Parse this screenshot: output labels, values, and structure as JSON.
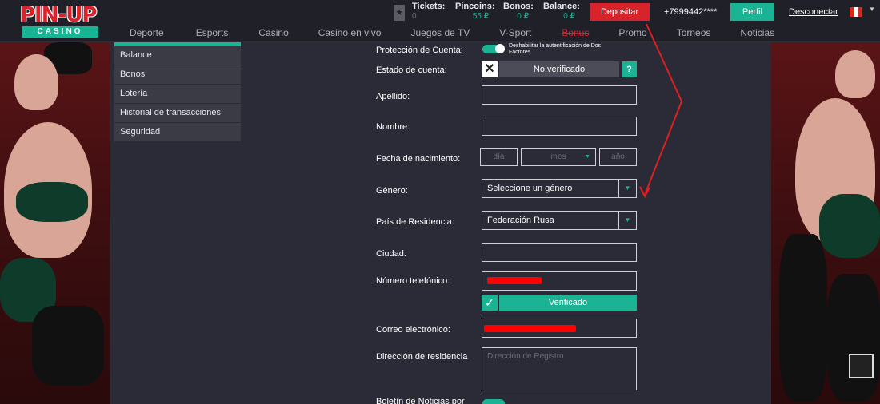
{
  "brand": {
    "logo_top": "PIN-UP",
    "logo_bottom": "CASINO"
  },
  "nav": [
    {
      "label": "Deporte"
    },
    {
      "label": "Esports"
    },
    {
      "label": "Casino"
    },
    {
      "label": "Casino en vivo"
    },
    {
      "label": "Juegos de TV"
    },
    {
      "label": "V-Sport"
    },
    {
      "label": "Bonus"
    },
    {
      "label": "Promo"
    },
    {
      "label": "Torneos"
    },
    {
      "label": "Noticias"
    }
  ],
  "account": {
    "tickets_label": "Tickets:",
    "tickets_value": "0",
    "pincoins_label": "Pincoins:",
    "pincoins_value": "55 ₽",
    "bonos_label": "Bonos:",
    "bonos_value": "0 ₽",
    "balance_label": "Balance:",
    "balance_value": "0 ₽",
    "deposit_label": "Depositar",
    "phone": "+7999442****",
    "profile_label": "Perfil",
    "logout_label": "Desconectar"
  },
  "sidebar": {
    "items": [
      {
        "label": "Balance"
      },
      {
        "label": "Bonos"
      },
      {
        "label": "Lotería"
      },
      {
        "label": "Historial de transacciones"
      },
      {
        "label": "Seguridad"
      }
    ]
  },
  "form": {
    "protection_label": "Protección de Cuenta:",
    "tfa_text": "Deshabilitar la autentificación de Dos Factores",
    "status_label": "Estado de cuenta:",
    "status_value": "No verificado",
    "help_symbol": "?",
    "lastname_label": "Apellido:",
    "lastname_value": "",
    "firstname_label": "Nombre:",
    "firstname_value": "",
    "birth_label": "Fecha de nacimiento:",
    "day_placeholder": "día",
    "month_placeholder": "mes",
    "year_placeholder": "año",
    "gender_label": "Género:",
    "gender_value": "Seleccione un género",
    "country_label": "País de Residencia:",
    "country_value": "Federación Rusa",
    "city_label": "Ciudad:",
    "city_value": "",
    "phone_label": "Número telefónico:",
    "verified_label": "Verificado",
    "email_label": "Correo electrónico:",
    "address_label": "Dirección de residencia",
    "address_placeholder": "Dirección de Registro",
    "newsletter_label": "Boletín de Noticias por"
  },
  "colors": {
    "accent": "#1ab394",
    "danger": "#d8232a",
    "panel": "#2a2b37"
  }
}
